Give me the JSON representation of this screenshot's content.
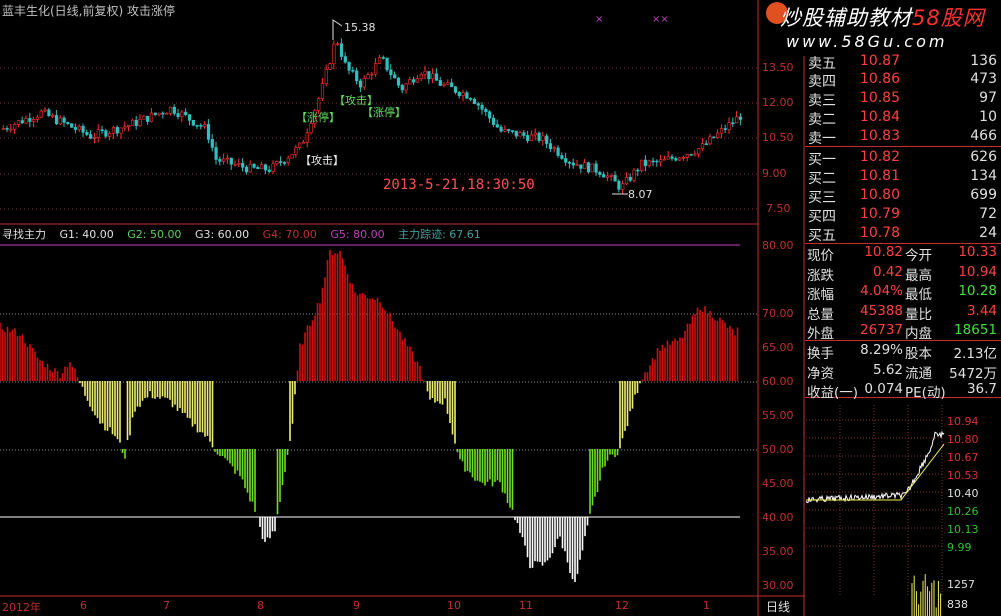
{
  "window": {
    "title": "蓝丰生化(日线,前复权) 攻击涨停"
  },
  "watermark": {
    "main": "炒股辅助教材",
    "brand": "58股网",
    "site": "www.58Gu.com"
  },
  "price_chart": {
    "y_ticks": [
      "13.50",
      "12.00",
      "10.50",
      "9.00",
      "7.50"
    ],
    "high_label": "15.38",
    "low_label": "8.07",
    "annotations": [
      "【攻击】",
      "【涨停】",
      "【涨停】",
      "【攻击】",
      "【攻击】"
    ],
    "timestamp": "2013-5-21,18:30:50"
  },
  "indicator": {
    "name": "寻找主力",
    "g1": "G1: 40.00",
    "g2": "G2: 50.00",
    "g3": "G3: 60.00",
    "g4": "G4: 70.00",
    "g5": "G5: 80.00",
    "track": "主力踪迹: 67.61",
    "y_ticks": [
      "80.00",
      "70.00",
      "65.00",
      "60.00",
      "55.00",
      "50.00",
      "45.00",
      "40.00",
      "35.00",
      "30.00"
    ]
  },
  "x_axis": {
    "labels": [
      "2012年",
      "6",
      "7",
      "8",
      "9",
      "10",
      "11",
      "12",
      "1"
    ],
    "period": "日线"
  },
  "order_book": {
    "sells": [
      {
        "label": "卖五",
        "price": "10.87",
        "qty": "136"
      },
      {
        "label": "卖四",
        "price": "10.86",
        "qty": "473"
      },
      {
        "label": "卖三",
        "price": "10.85",
        "qty": "97"
      },
      {
        "label": "卖二",
        "price": "10.84",
        "qty": "10"
      },
      {
        "label": "卖一",
        "price": "10.83",
        "qty": "466"
      }
    ],
    "buys": [
      {
        "label": "买一",
        "price": "10.82",
        "qty": "626"
      },
      {
        "label": "买二",
        "price": "10.81",
        "qty": "134"
      },
      {
        "label": "买三",
        "price": "10.80",
        "qty": "699"
      },
      {
        "label": "买四",
        "price": "10.79",
        "qty": "72"
      },
      {
        "label": "买五",
        "price": "10.78",
        "qty": "24"
      }
    ]
  },
  "quote": {
    "rows": [
      {
        "l1": "现价",
        "v1": "10.82",
        "l2": "今开",
        "v2": "10.33"
      },
      {
        "l1": "涨跌",
        "v1": "0.42",
        "l2": "最高",
        "v2": "10.94"
      },
      {
        "l1": "涨幅",
        "v1": "4.04%",
        "l2": "最低",
        "v2": "10.28"
      },
      {
        "l1": "总量",
        "v1": "45388",
        "l2": "量比",
        "v2": "3.44"
      },
      {
        "l1": "外盘",
        "v1": "26737",
        "l2": "内盘",
        "v2": "18651"
      }
    ],
    "rows2": [
      {
        "l1": "换手",
        "v1": "8.29%",
        "l2": "股本",
        "v2": "2.13亿"
      },
      {
        "l1": "净资",
        "v1": "5.62",
        "l2": "流通",
        "v2": "5472万"
      },
      {
        "l1": "收益(一)",
        "v1": "0.074",
        "l2": "PE(动)",
        "v2": "36.7"
      }
    ]
  },
  "mini_chart": {
    "y_ticks": [
      "10.94",
      "10.80",
      "10.67",
      "10.53",
      "10.40",
      "10.26",
      "10.13",
      "9.99"
    ],
    "vol_ticks": [
      "1257",
      "838"
    ]
  },
  "colors": {
    "up": "#ff3030",
    "down": "#30c0c0",
    "red_bar": "#d01010",
    "yellow_bar": "#f0f070",
    "green_bar": "#70e020",
    "white_bar": "#ffffff",
    "grid": "#803030"
  }
}
